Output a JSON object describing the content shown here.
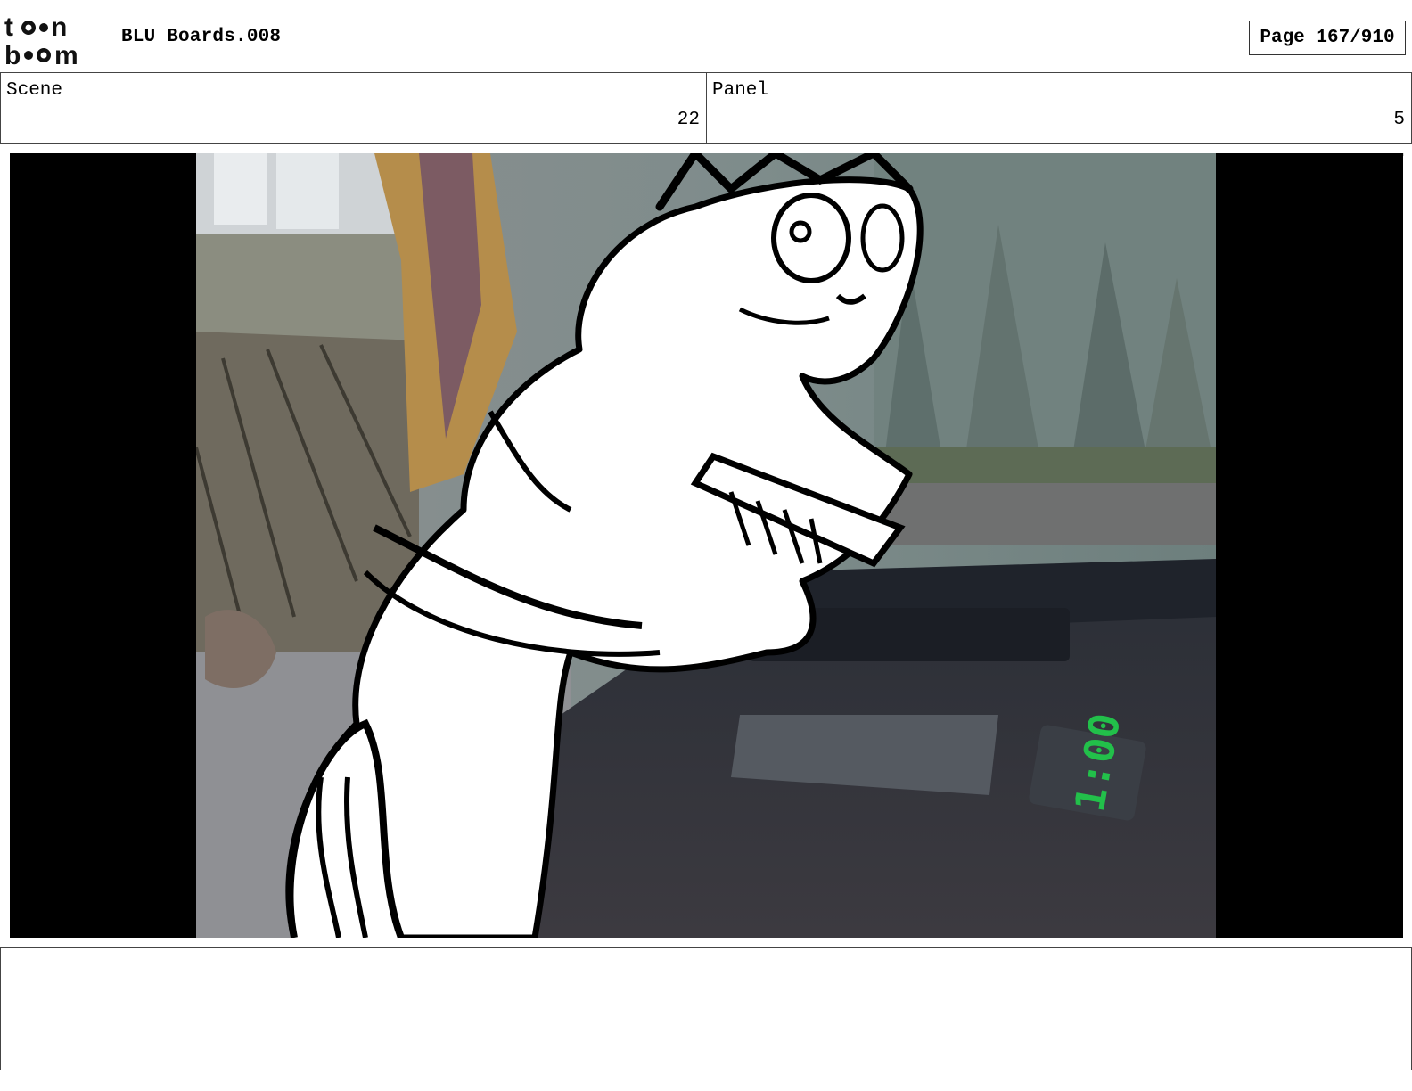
{
  "header": {
    "logo_text_top": "toon",
    "logo_text_bottom": "boom",
    "title": "BLU Boards.008",
    "page_label": "Page 167/910"
  },
  "info": {
    "scene_label": "Scene",
    "scene_value": "22",
    "panel_label": "Panel",
    "panel_value": "5"
  },
  "panel_image": {
    "timer_display": "1:00",
    "timer_color": "#22c04a"
  },
  "notes": {
    "text": ""
  }
}
